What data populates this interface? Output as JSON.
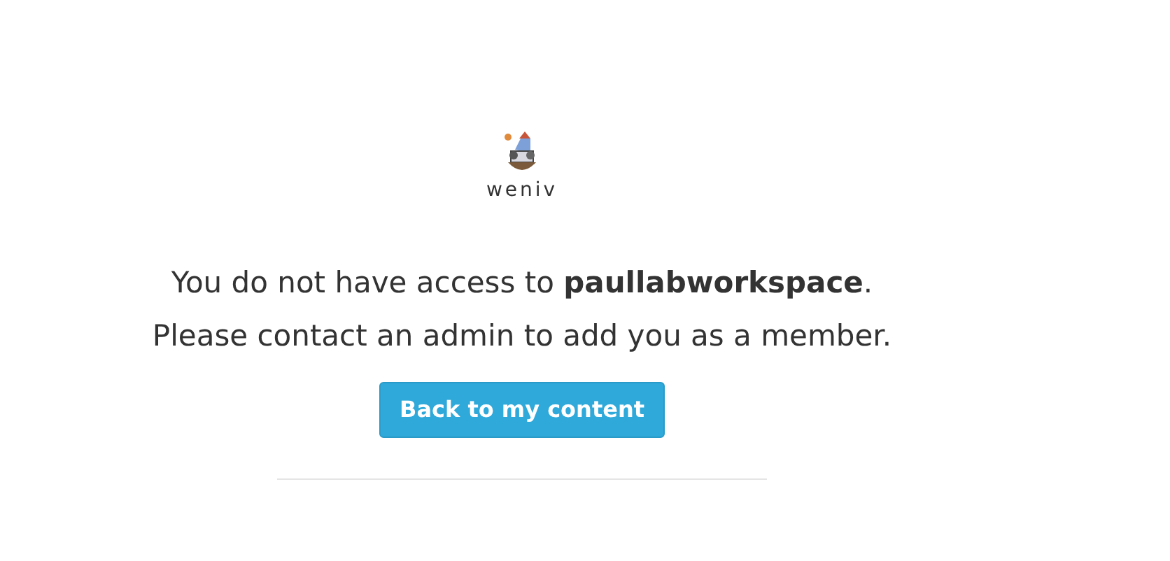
{
  "logo": {
    "wordmark": "weniv"
  },
  "message": "You do not have access to **paullabworkspace**. Please contact an admin to add you as a member.",
  "button": {
    "label": "Back to my content"
  }
}
